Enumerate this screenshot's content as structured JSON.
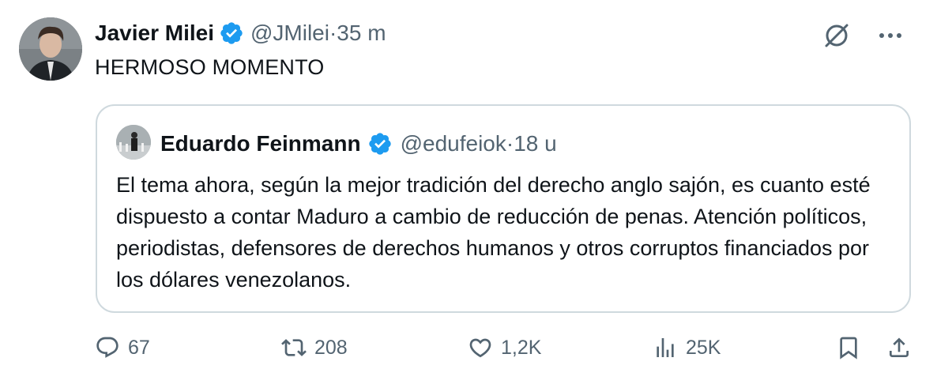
{
  "tweet": {
    "author_name": "Javier Milei",
    "handle": "@JMilei",
    "separator": "·",
    "time": "35 m",
    "text": "HERMOSO MOMENTO"
  },
  "quoted": {
    "author_name": "Eduardo Feinmann",
    "handle": "@edufeiok",
    "separator": "·",
    "time": "18 u",
    "text": "El tema ahora, según la mejor tradición del derecho anglo sajón, es cuanto esté dispuesto a contar Maduro a cambio de reducción de penas. Atención políticos, periodistas, defensores de derechos humanos y otros corruptos financiados por los dólares venezolanos."
  },
  "actions": {
    "replies": "67",
    "reposts": "208",
    "likes": "1,2K",
    "views": "25K"
  },
  "icons": {
    "verified": "verified-badge-icon",
    "grok": "grok-icon",
    "more": "more-icon",
    "reply": "reply-icon",
    "repost": "repost-icon",
    "like": "heart-icon",
    "views": "views-icon",
    "bookmark": "bookmark-icon",
    "share": "share-icon"
  },
  "colors": {
    "verified_blue": "#1d9bf0",
    "text_primary": "#0f1419",
    "text_secondary": "#536471",
    "border": "#cfd9de"
  }
}
